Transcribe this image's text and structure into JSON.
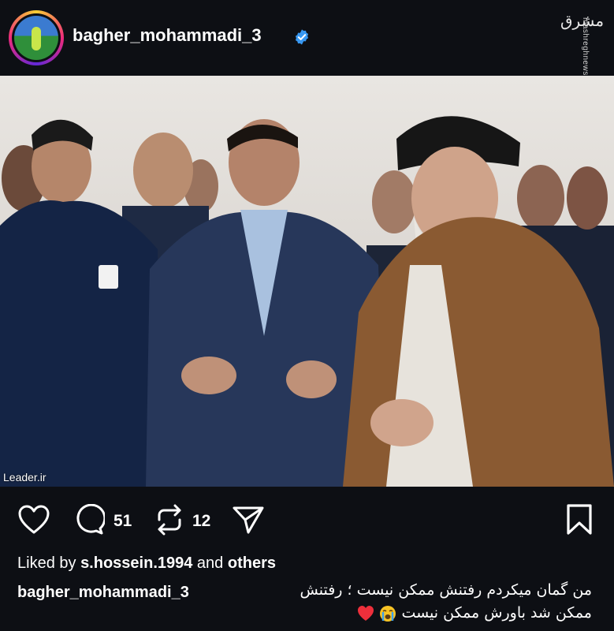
{
  "post": {
    "username": "bagher_mohammadi_3",
    "verified": true,
    "avatar_icon": "profile-avatar",
    "watermark": {
      "logo_text": "مشرق",
      "site": "mashreghnews.ir"
    },
    "photo": {
      "credit": "Leader.ir"
    },
    "actions": {
      "comment_count": "51",
      "repost_count": "12"
    },
    "likes": {
      "prefix": "Liked by ",
      "user": "s.hossein.1994",
      "middle": " and ",
      "others": "others"
    },
    "caption": {
      "username": "bagher_mohammadi_3",
      "line1": "من گمان میکردم رفتنش ممکن نیست ؛ رفتنش",
      "line2": "ممکن شد باورش ممکن نیست"
    }
  },
  "colors": {
    "background": "#0d0f14",
    "verified_blue": "#3897f0",
    "heart_red": "#ed2f3b"
  }
}
